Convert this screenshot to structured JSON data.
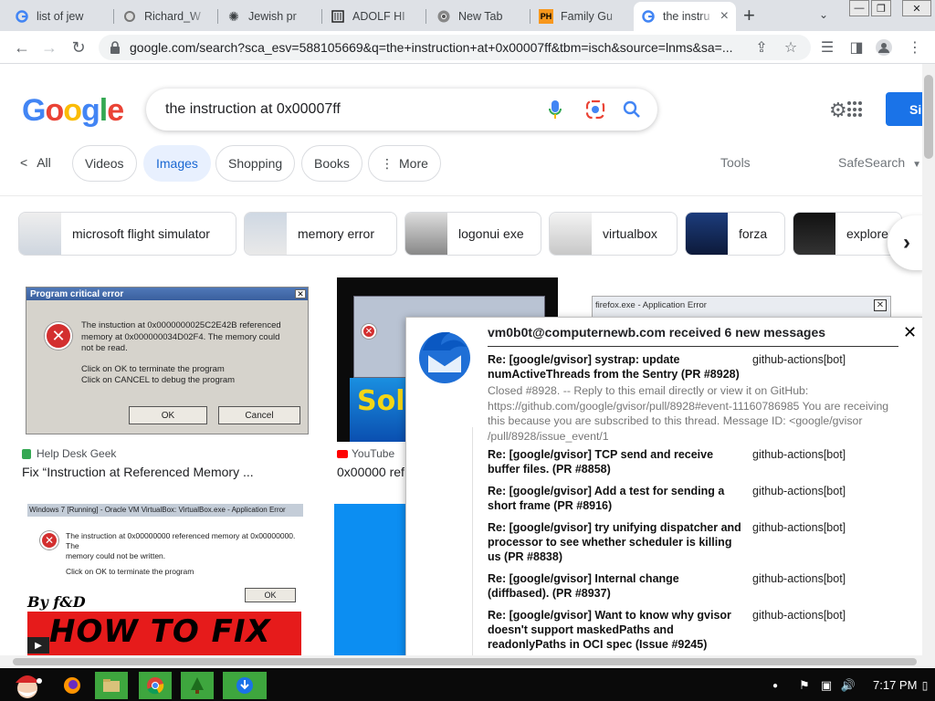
{
  "tabs": [
    {
      "title": "list of jew",
      "icon": "google-icon"
    },
    {
      "title": "Richard_W",
      "icon": "wikipedia-icon"
    },
    {
      "title": "Jewish pr",
      "icon": "sunburst-icon"
    },
    {
      "title": "ADOLF HI",
      "icon": "document-icon"
    },
    {
      "title": "New Tab",
      "icon": "chrome-icon"
    },
    {
      "title": "Family Gu",
      "icon": "ph-icon",
      "icon_text": "PH"
    },
    {
      "title": "the instru",
      "icon": "google-icon"
    }
  ],
  "address_bar": {
    "url": "google.com/search?sca_esv=588105669&q=the+instruction+at+0x00007ff&tbm=isch&source=lnms&sa=..."
  },
  "google": {
    "logo_text": "Google",
    "query": "the instruction at 0x00007ff",
    "signin_label": "Si"
  },
  "filters": {
    "all": "All",
    "chips": [
      "Videos",
      "Images",
      "Shopping",
      "Books",
      "More"
    ],
    "active": "Images",
    "tools": "Tools",
    "safesearch": "SafeSearch"
  },
  "related": [
    "microsoft flight simulator",
    "memory error",
    "logonui exe",
    "virtualbox",
    "forza",
    "explore"
  ],
  "results": [
    {
      "source": "Help Desk Geek",
      "title": "Fix “Instruction at Referenced Memory ...",
      "dialog_title": "Program critical error",
      "dialog_line1": "The instuction at 0x0000000025C2E42B referenced",
      "dialog_line2": "memory at 0x000000034D02F4. The memory could",
      "dialog_line3": "not be read.",
      "dialog_line4": "Click on OK to terminate the program",
      "dialog_line5": "Click on CANCEL to debug the program",
      "ok": "OK",
      "cancel": "Cancel"
    },
    {
      "source": "YouTube",
      "title": "0x00000 ref",
      "thumb_text": "Solv"
    },
    {
      "dialog_title": "firefox.exe - Application Error"
    },
    {
      "dialog_title": "Windows 7 [Running] - Oracle VM VirtualBox: VirtualBox.exe - Application Error",
      "dialog_line1": "The instruction at 0x00000000 referenced memory at 0x00000000. The",
      "dialog_line2": "memory could not be written.",
      "dialog_line3": "Click on OK to terminate the program",
      "ok": "OK",
      "by": "By f&D",
      "howto": "HOW TO FIX"
    }
  ],
  "notification": {
    "header": "vm0b0t@computernewb.com received 6 new messages",
    "messages": [
      {
        "subject": "Re: [google/gvisor] systrap: update numActiveThreads from the Sentry (PR #8928)",
        "from": "github-actions[bot]",
        "preview": "Closed #8928. -- Reply to this email directly or view it on GitHub: https://github.com/google/gvisor/pull/8928#event-11160786985 You are receiving this because you are subscribed to this thread. Message ID: <google/gvisor /pull/8928/issue_event/1"
      },
      {
        "subject": "Re: [google/gvisor] TCP send and receive buffer files. (PR #8858)",
        "from": "github-actions[bot]"
      },
      {
        "subject": "Re: [google/gvisor] Add a test for sending a short frame (PR #8916)",
        "from": "github-actions[bot]"
      },
      {
        "subject": "Re: [google/gvisor] try unifying dispatcher and processor to see whether scheduler is killing us (PR #8838)",
        "from": "github-actions[bot]"
      },
      {
        "subject": "Re: [google/gvisor] Internal change (diffbased). (PR #8937)",
        "from": "github-actions[bot]"
      },
      {
        "subject": "Re: [google/gvisor] Want to know why gvisor doesn't support maskedPaths and readonlyPaths in OCI spec (Issue #9245)",
        "from": "github-actions[bot]"
      }
    ]
  },
  "taskbar": {
    "clock": "7:17 PM"
  },
  "colors": {
    "accent_blue": "#1a73e8",
    "chip_active_bg": "#e8f0fe",
    "taskbar": "#0a0a0a",
    "youtube_red": "#ff0000"
  }
}
